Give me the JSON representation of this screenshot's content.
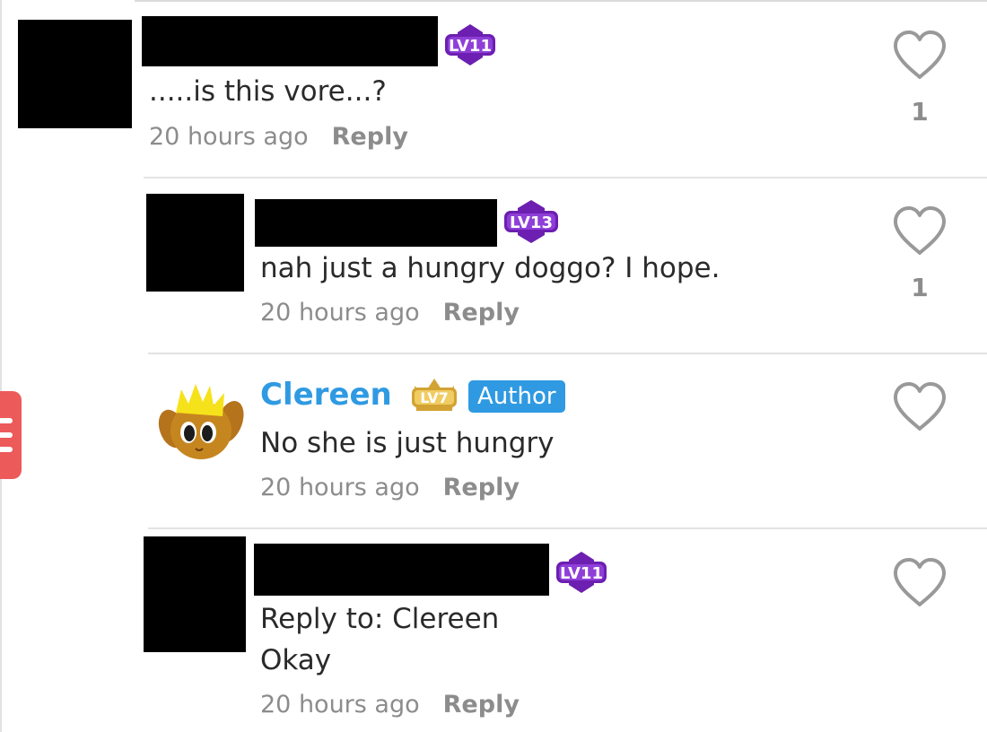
{
  "comments": [
    {
      "level": "LV11",
      "text": ".....is this vore...?",
      "time": "20 hours ago",
      "reply": "Reply",
      "likes": "1"
    },
    {
      "level": "LV13",
      "text": "nah just a hungry doggo? I hope.",
      "time": "20 hours ago",
      "reply": "Reply",
      "likes": "1"
    },
    {
      "name": "Clereen",
      "level": "LV7",
      "author_badge": "Author",
      "text": "No she is just hungry",
      "time": "20 hours ago",
      "reply": "Reply"
    },
    {
      "level": "LV11",
      "reply_to": "Reply to: Clereen",
      "text": "Okay",
      "time": "20 hours ago",
      "reply": "Reply"
    }
  ],
  "colors": {
    "username": "#2f9ae2",
    "author_badge": "#2f9ae2",
    "level_purple": "#6c1fb0",
    "level_gold": "#d2a332",
    "side_tab": "#ec5a5a",
    "meta_gray": "#8c8c8c"
  },
  "icons": [
    "heart-outline-icon",
    "level-badge-icon",
    "menu-lines-icon"
  ]
}
